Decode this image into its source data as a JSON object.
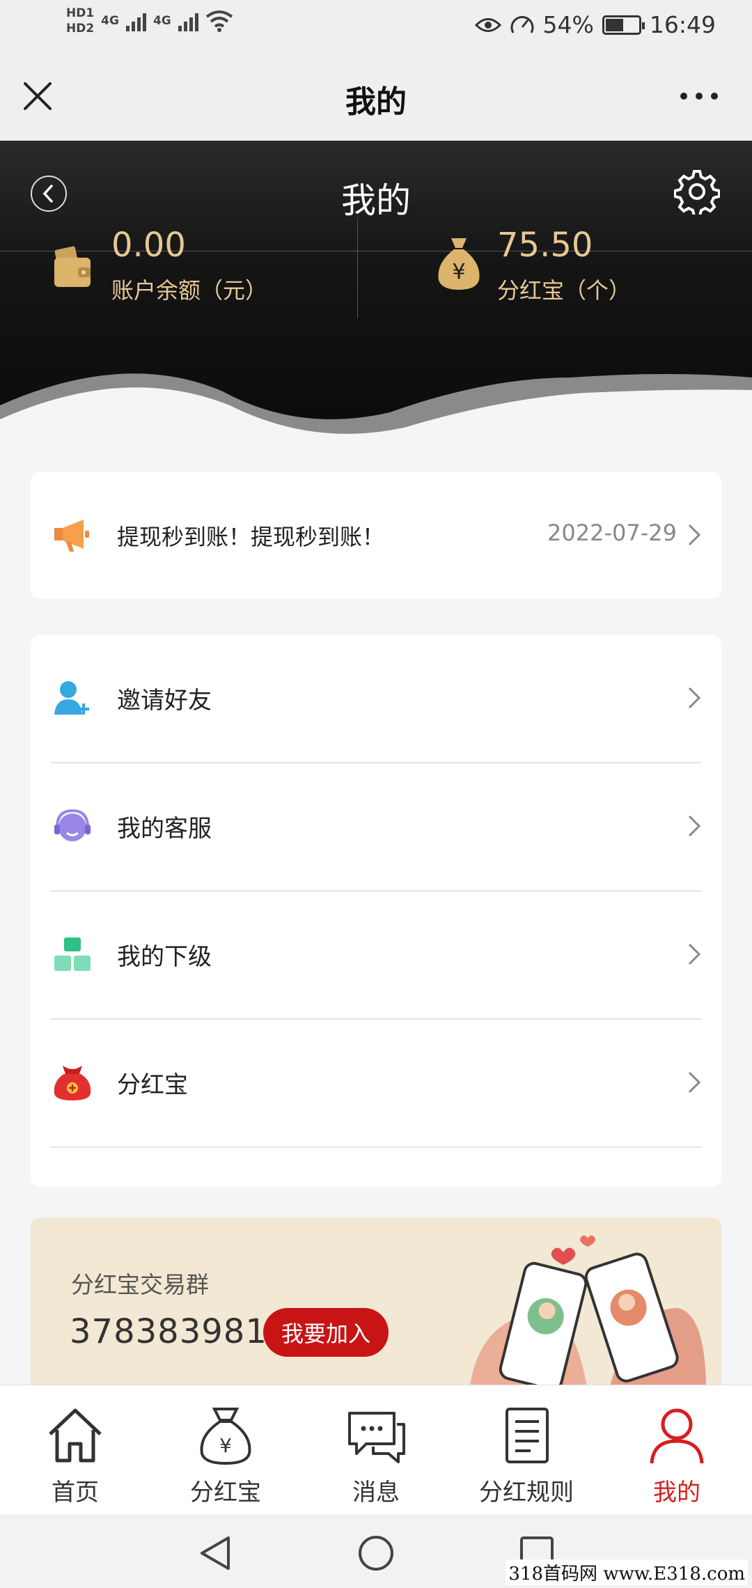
{
  "status_bar": {
    "hd1": "HD1",
    "hd2": "HD2",
    "net1": "4G",
    "net2": "4G",
    "battery_percent": "54%",
    "battery_level": 0.54,
    "time": "16:49"
  },
  "title_bar": {
    "title": "我的",
    "close_icon": "close-icon",
    "more_icon": "more-icon"
  },
  "hero": {
    "title": "我的",
    "balance": {
      "value": "0.00",
      "label": "账户余额（元）",
      "icon": "wallet-icon"
    },
    "dividend": {
      "value": "75.50",
      "label": "分红宝（个）",
      "icon": "money-bag-icon"
    },
    "accent_color": "#e6c894"
  },
  "notice": {
    "text": "提现秒到账！提现秒到账！",
    "date": "2022-07-29",
    "icon": "megaphone-icon"
  },
  "menu": {
    "items": [
      {
        "label": "邀请好友",
        "icon": "invite-user-icon"
      },
      {
        "label": "我的客服",
        "icon": "headset-icon"
      },
      {
        "label": "我的下级",
        "icon": "blocks-icon"
      },
      {
        "label": "分红宝",
        "icon": "red-pouch-icon"
      }
    ]
  },
  "banner": {
    "title": "分红宝交易群",
    "group_number": "378383981",
    "join_label": "我要加入",
    "join_color": "#c81414"
  },
  "tabbar": {
    "tabs": [
      {
        "label": "首页",
        "icon": "home-icon"
      },
      {
        "label": "分红宝",
        "icon": "money-bag-icon"
      },
      {
        "label": "消息",
        "icon": "chat-icon"
      },
      {
        "label": "分红规则",
        "icon": "document-icon"
      },
      {
        "label": "我的",
        "icon": "user-icon",
        "active": true
      }
    ],
    "active_color": "#d81e1e"
  },
  "watermark": "318首码网 www.E318.com"
}
